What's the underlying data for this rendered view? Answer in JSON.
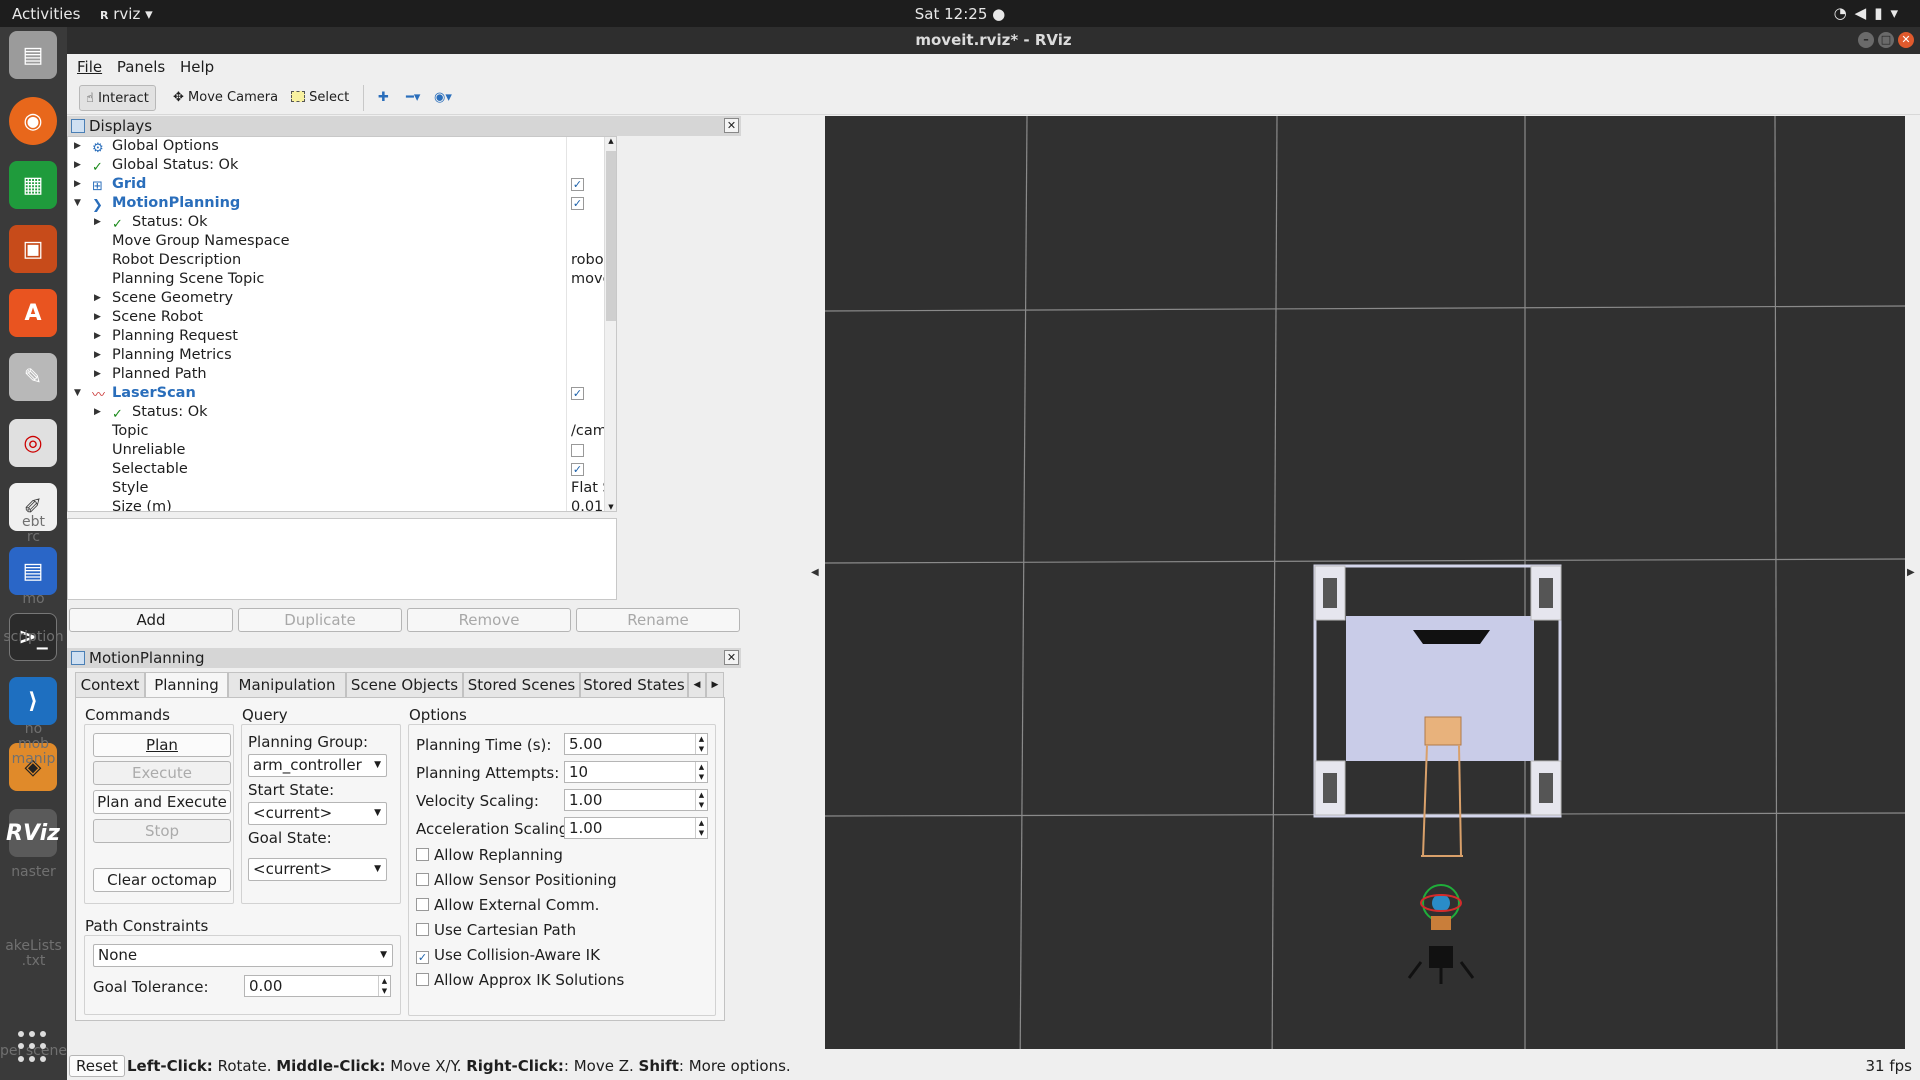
{
  "topbar": {
    "activities": "Activities",
    "app_menu": "rviz",
    "clock": "Sat 12:25 ●"
  },
  "dock": {
    "ghost_texts": [
      "ebt",
      "rc",
      "mo",
      "scription",
      "no",
      "mob",
      "manip",
      "naster",
      "akeLists",
      ".txt",
      "pel scene"
    ]
  },
  "window": {
    "title": "moveit.rviz* - RViz"
  },
  "menubar": {
    "file": "File",
    "panels": "Panels",
    "help": "Help"
  },
  "toolbar": {
    "interact": "Interact",
    "move_camera": "Move Camera",
    "select": "Select"
  },
  "displays": {
    "title": "Displays",
    "rows": [
      {
        "label": "Global Options"
      },
      {
        "label": "Global Status: Ok"
      },
      {
        "label": "Grid",
        "checked": true
      },
      {
        "label": "MotionPlanning",
        "checked": true
      },
      {
        "label": "Status: Ok"
      },
      {
        "label": "Move Group Namespace",
        "value": ""
      },
      {
        "label": "Robot Description",
        "value": "robot_description"
      },
      {
        "label": "Planning Scene Topic",
        "value": "move_group/monitor..."
      },
      {
        "label": "Scene Geometry"
      },
      {
        "label": "Scene Robot"
      },
      {
        "label": "Planning Request"
      },
      {
        "label": "Planning Metrics"
      },
      {
        "label": "Planned Path"
      },
      {
        "label": "LaserScan",
        "checked": true
      },
      {
        "label": "Status: Ok"
      },
      {
        "label": "Topic",
        "value": "/camera/scan"
      },
      {
        "label": "Unreliable",
        "checked": false
      },
      {
        "label": "Selectable",
        "checked": true
      },
      {
        "label": "Style",
        "value": "Flat Squares"
      },
      {
        "label": "Size (m)",
        "value": "0.01"
      }
    ],
    "buttons": {
      "add": "Add",
      "duplicate": "Duplicate",
      "remove": "Remove",
      "rename": "Rename"
    }
  },
  "motion_planning": {
    "title": "MotionPlanning",
    "tabs": [
      "Context",
      "Planning",
      "Manipulation",
      "Scene Objects",
      "Stored Scenes",
      "Stored States"
    ],
    "selected_tab": "Planning",
    "commands": {
      "title": "Commands",
      "plan": "Plan",
      "execute": "Execute",
      "plan_execute": "Plan and Execute",
      "stop": "Stop",
      "clear_octomap": "Clear octomap"
    },
    "query": {
      "title": "Query",
      "planning_group_label": "Planning Group:",
      "planning_group": "arm_controller",
      "start_state_label": "Start State:",
      "start_state": "<current>",
      "goal_state_label": "Goal State:",
      "goal_state": "<current>"
    },
    "options": {
      "title": "Options",
      "planning_time_label": "Planning Time (s):",
      "planning_time": "5.00",
      "planning_attempts_label": "Planning Attempts:",
      "planning_attempts": "10",
      "velocity_scaling_label": "Velocity Scaling:",
      "velocity_scaling": "1.00",
      "acceleration_scaling_label": "Acceleration Scaling:",
      "acceleration_scaling": "1.00",
      "checks": [
        {
          "label": "Allow Replanning",
          "checked": false
        },
        {
          "label": "Allow Sensor Positioning",
          "checked": false
        },
        {
          "label": "Allow External Comm.",
          "checked": false
        },
        {
          "label": "Use Cartesian Path",
          "checked": false
        },
        {
          "label": "Use Collision-Aware IK",
          "checked": true
        },
        {
          "label": "Allow Approx IK Solutions",
          "checked": false
        }
      ]
    },
    "path_constraints": {
      "title": "Path Constraints",
      "value": "None",
      "goal_tolerance_label": "Goal Tolerance:",
      "goal_tolerance": "0.00"
    }
  },
  "statusbar": {
    "reset": "Reset",
    "left_click": "Left-Click:",
    "left_click_desc": " Rotate. ",
    "middle_click": "Middle-Click:",
    "middle_click_desc": " Move X/Y. ",
    "right_click": "Right-Click:",
    "right_click_desc": ": Move Z. ",
    "shift": "Shift",
    "shift_desc": ": More options.",
    "fps": "31 fps"
  },
  "colors": {
    "viewport_bg": "#303030",
    "grid": "#8a8a8a",
    "robot_plate": "#c9cce8",
    "accent_blue": "#2a6ebb"
  }
}
